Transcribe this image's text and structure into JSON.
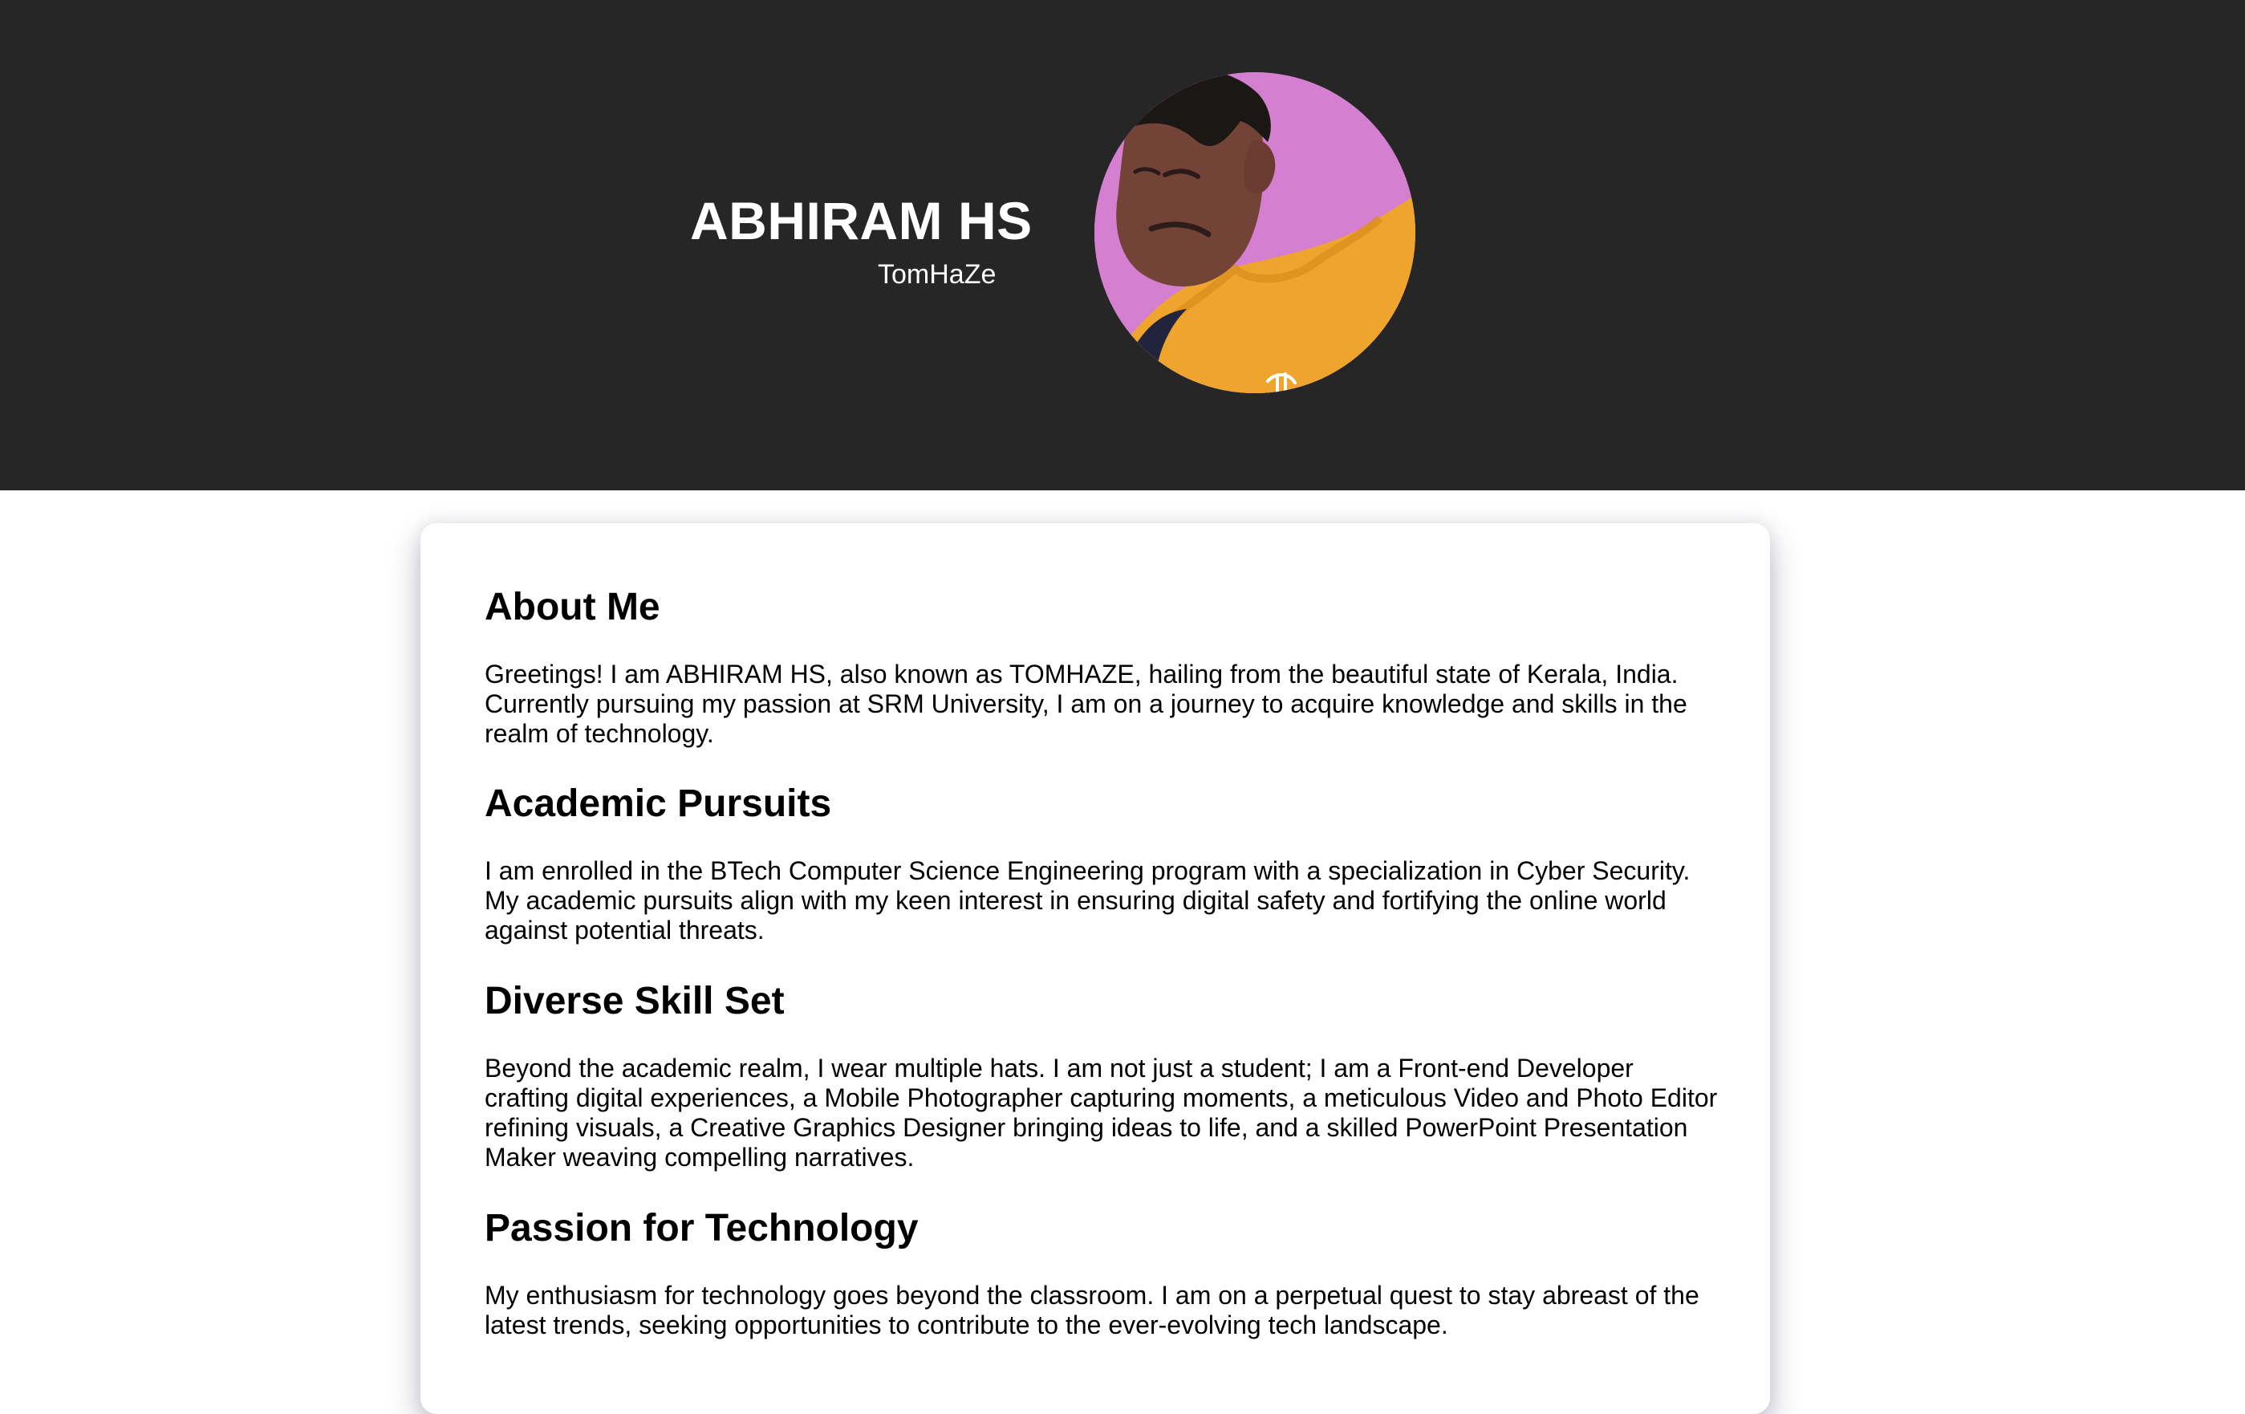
{
  "header": {
    "name": "ABHIRAM HS",
    "alias": "TomHaZe",
    "avatar_icon": "profile-photo-icon"
  },
  "sections": [
    {
      "title": "About Me",
      "text": "Greetings! I am ABHIRAM HS, also known as TOMHAZE, hailing from the beautiful state of Kerala, India. Currently pursuing my passion at SRM University, I am on a journey to acquire knowledge and skills in the realm of technology."
    },
    {
      "title": "Academic Pursuits",
      "text": "I am enrolled in the BTech Computer Science Engineering program with a specialization in Cyber Security. My academic pursuits align with my keen interest in ensuring digital safety and fortifying the online world against potential threats."
    },
    {
      "title": "Diverse Skill Set",
      "text": "Beyond the academic realm, I wear multiple hats. I am not just a student; I am a Front-end Developer crafting digital experiences, a Mobile Photographer capturing moments, a meticulous Video and Photo Editor refining visuals, a Creative Graphics Designer bringing ideas to life, and a skilled PowerPoint Presentation Maker weaving compelling narratives."
    },
    {
      "title": "Passion for Technology",
      "text": "My enthusiasm for technology goes beyond the classroom. I am on a perpetual quest to stay abreast of the latest trends, seeking opportunities to contribute to the ever-evolving tech landscape."
    }
  ],
  "colors": {
    "header_background": "#262626",
    "page_background": "#ffffff",
    "text_on_dark": "#ffffff",
    "text_primary": "#000000",
    "avatar_background": "#d783d2",
    "shirt_accent": "#efa52d"
  }
}
